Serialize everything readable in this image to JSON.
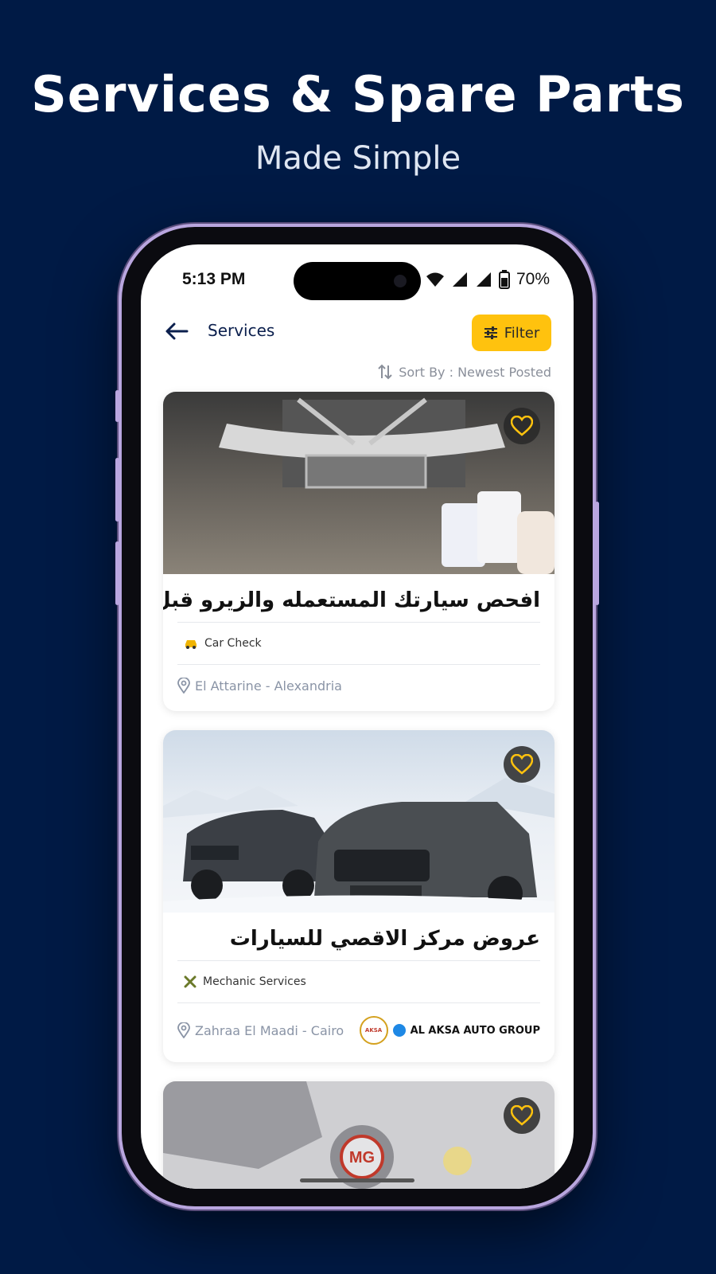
{
  "hero": {
    "title": "Services & Spare Parts",
    "subtitle": "Made Simple"
  },
  "status_bar": {
    "time": "5:13 PM",
    "battery": "70%"
  },
  "app_bar": {
    "title": "Services",
    "filter_label": "Filter"
  },
  "sort": {
    "label": "Sort By : Newest Posted"
  },
  "listings": [
    {
      "title": "افحص سيارتك المستعمله والزيرو قبل...",
      "category": "Car Check",
      "location": "El Attarine - Alexandria",
      "category_icon": "car-check-icon"
    },
    {
      "title": "عروض مركز الاقصي للسيارات",
      "category": "Mechanic Services",
      "location": "Zahraa El Maadi - Cairo",
      "category_icon": "tools-icon",
      "dealer": "AL AKSA AUTO GROUP",
      "dealer_logo_text": "AKSA"
    },
    {
      "logo_text": "MG"
    }
  ],
  "colors": {
    "background": "#001a45",
    "accent": "#ffc20e",
    "primary_text": "#0b1f4d"
  }
}
